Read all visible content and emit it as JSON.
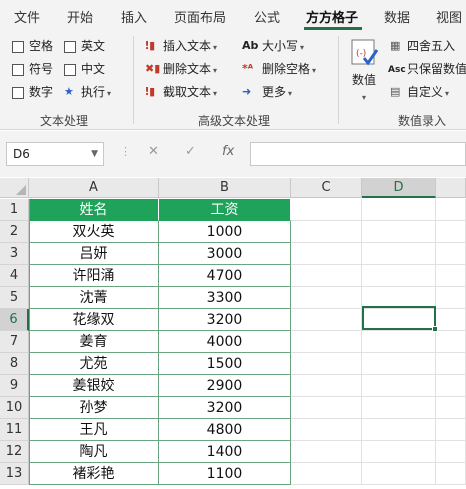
{
  "ribbon_tabs": [
    "文件",
    "开始",
    "插入",
    "页面布局",
    "公式",
    "方方格子",
    "数据",
    "视图"
  ],
  "active_tab": "方方格子",
  "text_group": {
    "checkboxes": [
      "空格",
      "英文",
      "符号",
      "中文",
      "数字"
    ],
    "run_label": "执行",
    "label": "文本处理"
  },
  "advanced_group": {
    "insert_text": "插入文本",
    "delete_text": "删除文本",
    "extract_text": "截取文本",
    "case": "大小写",
    "delete_spaces": "删除空格",
    "more": "更多",
    "case_icon": "Ab",
    "label": "高级文本处理"
  },
  "number_group": {
    "numeric": "数值",
    "round": "四舍五入",
    "keep_numbers": "只保留数值",
    "custom": "自定义",
    "keep_icon": "Asc",
    "label": "数值录入"
  },
  "formula_bar": {
    "name_box": "D6",
    "cancel": "✕",
    "enter": "✓",
    "fx": "fx"
  },
  "columns": [
    "A",
    "B",
    "C",
    "D"
  ],
  "selected_column": "D",
  "selected_row": 6,
  "table": {
    "headers": [
      "姓名",
      "工资"
    ],
    "rows": [
      [
        "双火英",
        "1000"
      ],
      [
        "吕妍",
        "3000"
      ],
      [
        "许阳涌",
        "4700"
      ],
      [
        "沈菁",
        "3300"
      ],
      [
        "花缘双",
        "3200"
      ],
      [
        "姜育",
        "4000"
      ],
      [
        "尤苑",
        "1500"
      ],
      [
        "姜银姣",
        "2900"
      ],
      [
        "孙梦",
        "3200"
      ],
      [
        "王凡",
        "4800"
      ],
      [
        "陶凡",
        "1400"
      ],
      [
        "褚彩艳",
        "1100"
      ]
    ]
  },
  "row_numbers": [
    "1",
    "2",
    "3",
    "4",
    "5",
    "6",
    "7",
    "8",
    "9",
    "10",
    "11",
    "12",
    "13"
  ],
  "colors": {
    "accent": "#217346",
    "header_fill": "#1fa25a",
    "table_border": "#6aa57f"
  }
}
